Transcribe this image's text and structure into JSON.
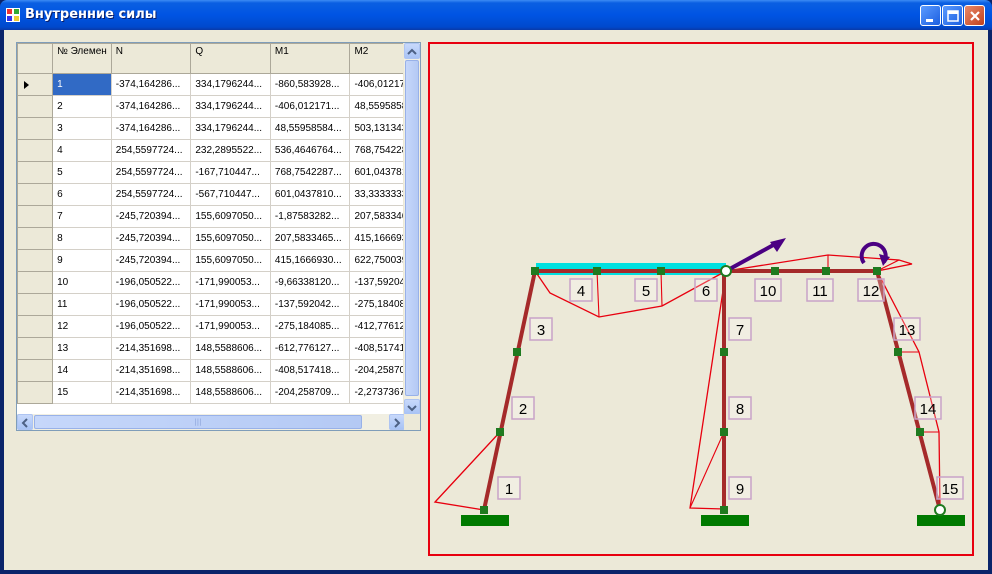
{
  "window": {
    "title": "Внутренние силы"
  },
  "table": {
    "columns": [
      "№ Элемен",
      "N",
      "Q",
      "M1",
      "M2"
    ],
    "rows": [
      [
        "1",
        "-374,164286...",
        "334,1796244...",
        "-860,583928...",
        "-406,01217"
      ],
      [
        "2",
        "-374,164286...",
        "334,1796244...",
        "-406,012171...",
        "48,5595858"
      ],
      [
        "3",
        "-374,164286...",
        "334,1796244...",
        "48,55958584...",
        "503,131343"
      ],
      [
        "4",
        "254,5597724...",
        "232,2895522...",
        "536,4646764...",
        "768,754228"
      ],
      [
        "5",
        "254,5597724...",
        "-167,710447...",
        "768,7542287...",
        "601,043781"
      ],
      [
        "6",
        "254,5597724...",
        "-567,710447...",
        "601,0437810...",
        "33,3333333"
      ],
      [
        "7",
        "-245,720394...",
        "155,6097050...",
        "-1,87583282...",
        "207,583346"
      ],
      [
        "8",
        "-245,720394...",
        "155,6097050...",
        "207,5833465...",
        "415,166693"
      ],
      [
        "9",
        "-245,720394...",
        "155,6097050...",
        "415,1666930...",
        "622,750039"
      ],
      [
        "10",
        "-196,050522...",
        "-171,990053...",
        "-9,66338120...",
        "-137,592042"
      ],
      [
        "11",
        "-196,050522...",
        "-171,990053...",
        "-137,592042...",
        "-275,184085"
      ],
      [
        "12",
        "-196,050522...",
        "-171,990053...",
        "-275,184085...",
        "-412,776127"
      ],
      [
        "13",
        "-214,351698...",
        "148,5588606...",
        "-612,776127...",
        "-408,517418"
      ],
      [
        "14",
        "-214,351698...",
        "148,5588606...",
        "-408,517418...",
        "-204,258709"
      ],
      [
        "15",
        "-214,351698...",
        "148,5588606...",
        "-204,258709...",
        "-2,27373675"
      ]
    ],
    "scroll_thumb_label": "|||"
  },
  "frame_labels": [
    "1",
    "2",
    "3",
    "4",
    "5",
    "6",
    "7",
    "8",
    "9",
    "10",
    "11",
    "12",
    "13",
    "14",
    "15"
  ],
  "colors": {
    "frame": "#a52a2a",
    "diagram": "#e8000f",
    "node": "#1f7a1f",
    "support": "#007a00",
    "load_bar": "#00e0e0",
    "force_arrow": "#4b0082",
    "label_box": "#c8a2c8"
  },
  "icons": {
    "app": "app-window-icon",
    "minimize": "minimize-icon",
    "maximize": "maximize-icon",
    "close": "close-icon"
  }
}
